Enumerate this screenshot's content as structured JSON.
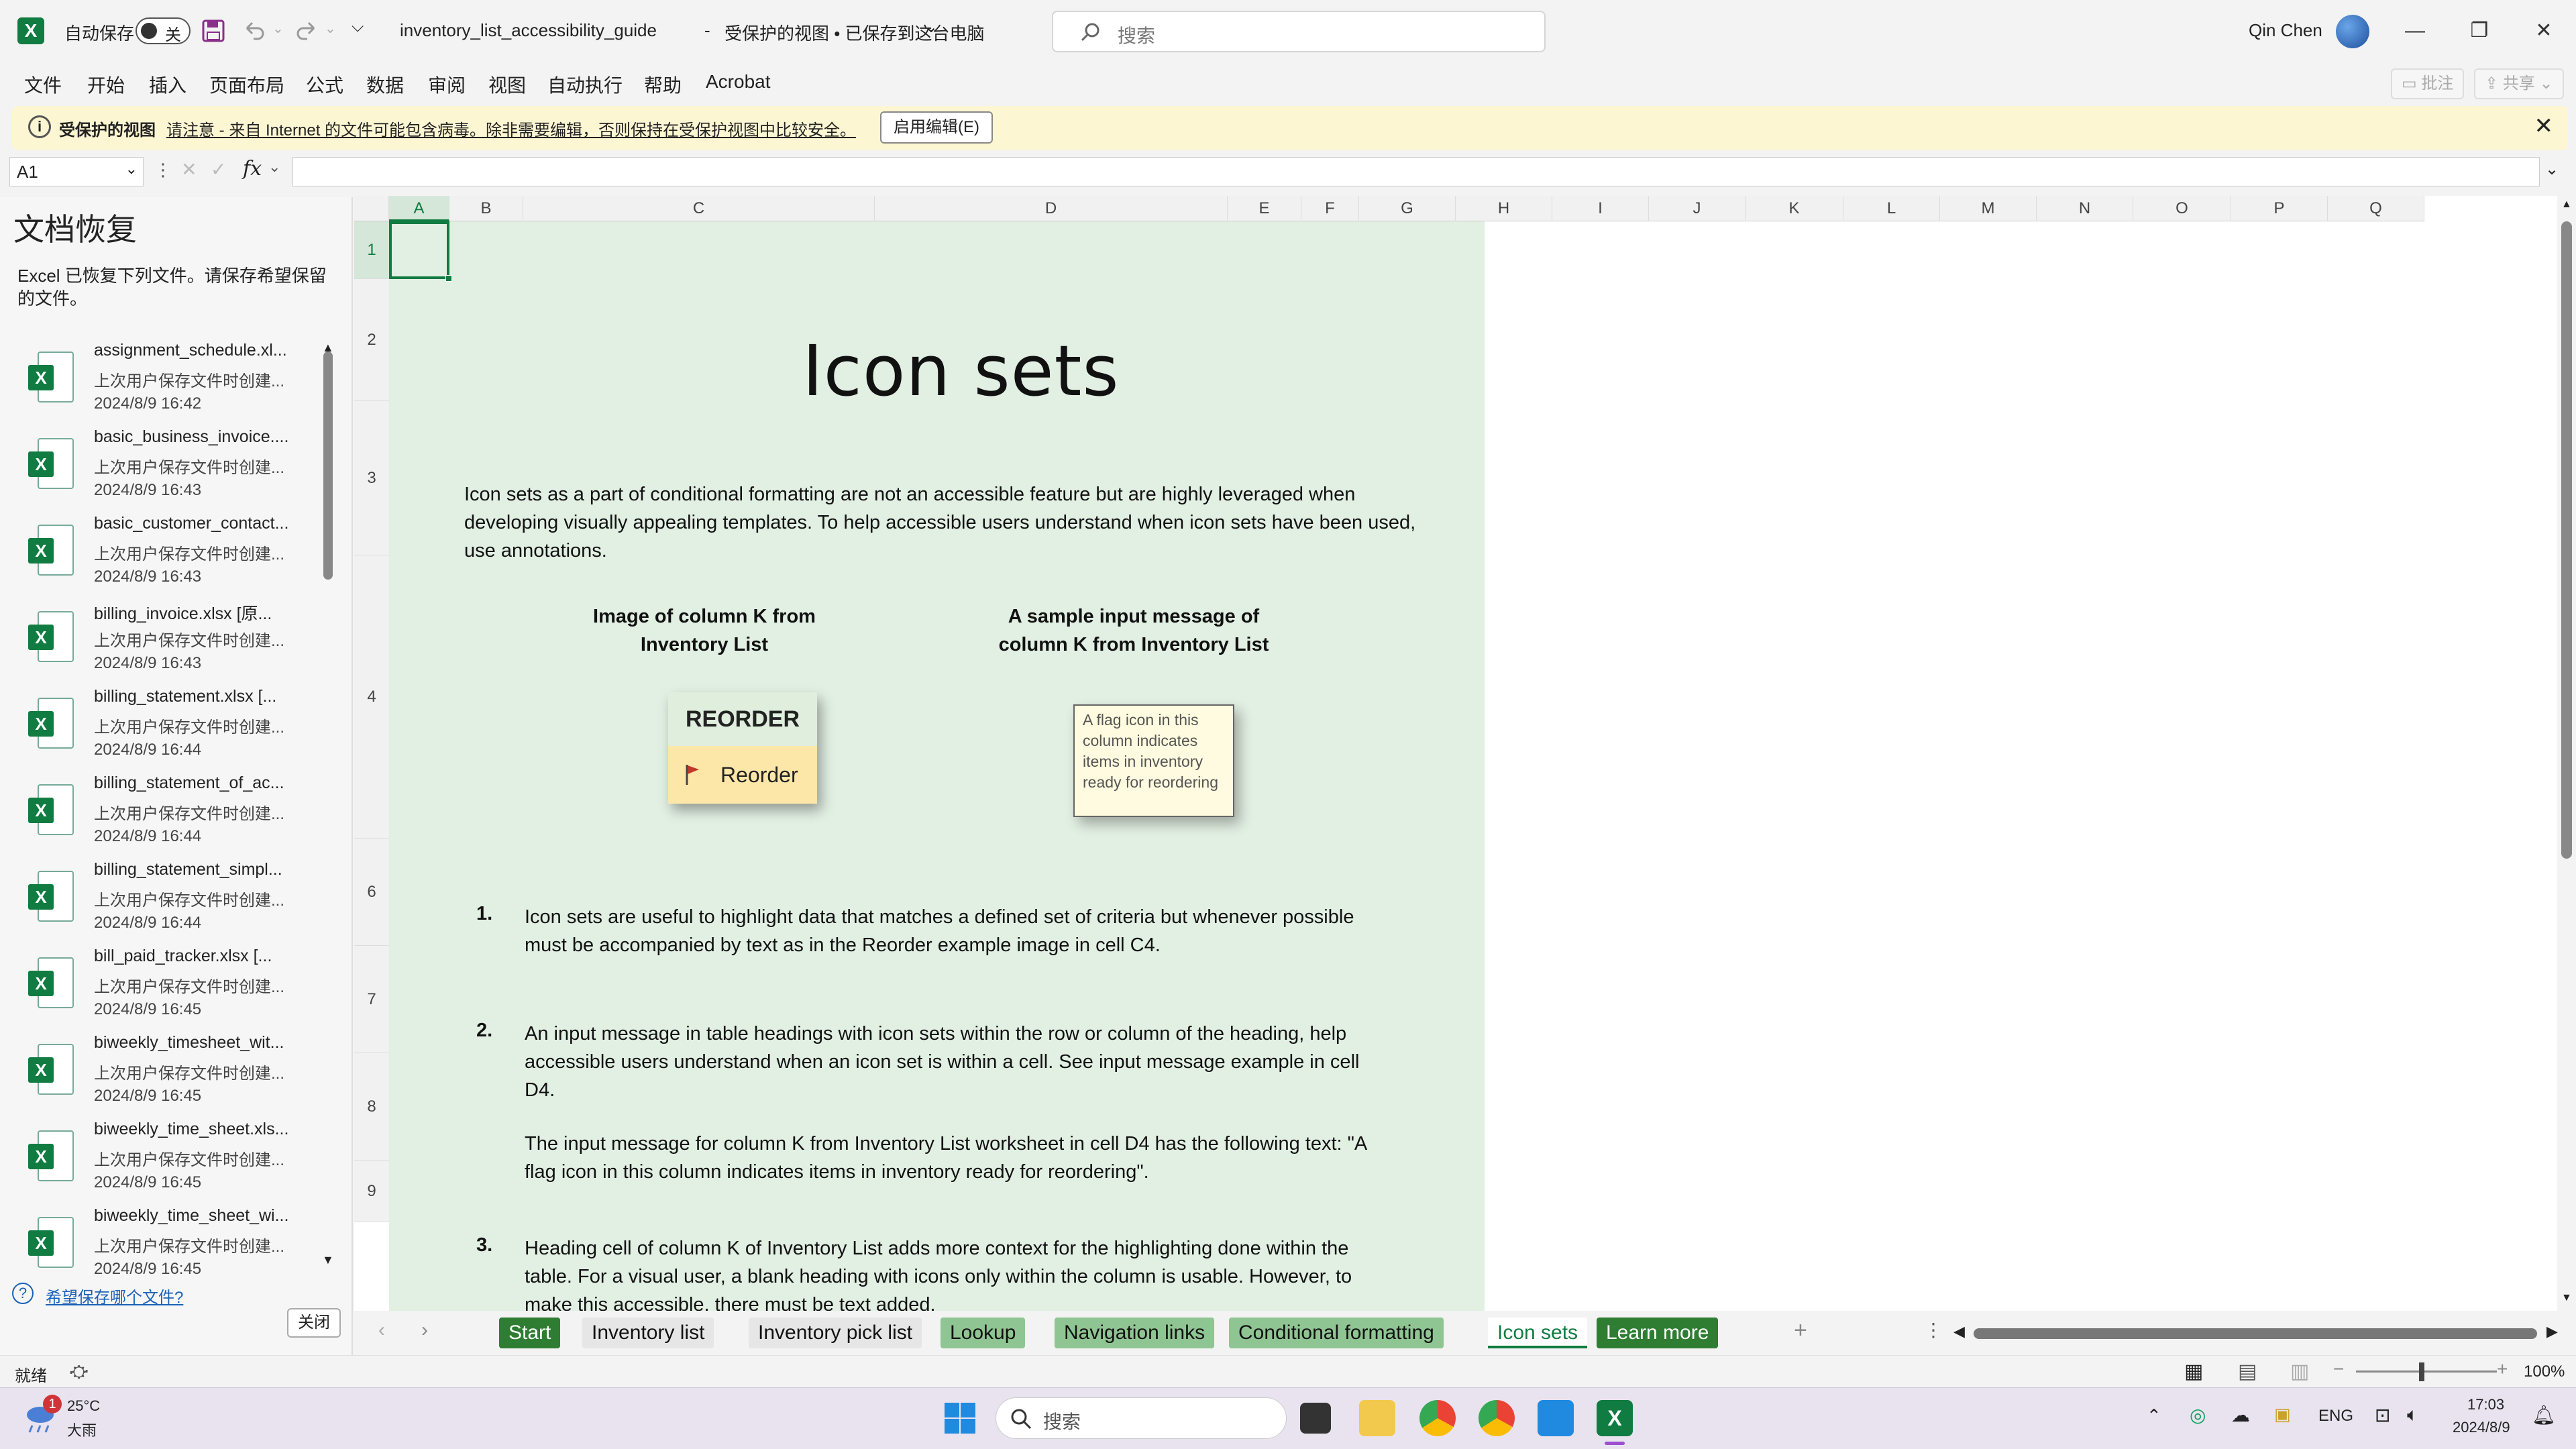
{
  "titlebar": {
    "autosave_label": "自动保存",
    "autosave_state": "关",
    "filename": "inventory_list_accessibility_guide",
    "separator": "-",
    "status": "受保护的视图 • 已保存到这台电脑",
    "search_placeholder": "搜索",
    "user_name": "Qin Chen"
  },
  "menu": {
    "items": [
      "文件",
      "开始",
      "插入",
      "页面布局",
      "公式",
      "数据",
      "审阅",
      "视图",
      "自动执行",
      "帮助",
      "Acrobat"
    ],
    "comments": "批注",
    "share": "共享"
  },
  "protected_bar": {
    "title": "受保护的视图",
    "message": "请注意 - 来自 Internet 的文件可能包含病毒。除非需要编辑，否则保持在受保护视图中比较安全。",
    "enable_button": "启用编辑(E)"
  },
  "formula_bar": {
    "name_box": "A1",
    "fx": "fx",
    "value": ""
  },
  "recovery": {
    "title": "文档恢复",
    "description": "Excel 已恢复下列文件。请保存希望保留的文件。",
    "files": [
      {
        "name": "assignment_schedule.xl...",
        "line": "上次用户保存文件时创建...",
        "date": "2024/8/9 16:42"
      },
      {
        "name": "basic_business_invoice....",
        "line": "上次用户保存文件时创建...",
        "date": "2024/8/9 16:43"
      },
      {
        "name": "basic_customer_contact...",
        "line": "上次用户保存文件时创建...",
        "date": "2024/8/9 16:43"
      },
      {
        "name": "billing_invoice.xlsx  [原...",
        "line": "上次用户保存文件时创建...",
        "date": "2024/8/9 16:43"
      },
      {
        "name": "billing_statement.xlsx  [...",
        "line": "上次用户保存文件时创建...",
        "date": "2024/8/9 16:44"
      },
      {
        "name": "billing_statement_of_ac...",
        "line": "上次用户保存文件时创建...",
        "date": "2024/8/9 16:44"
      },
      {
        "name": "billing_statement_simpl...",
        "line": "上次用户保存文件时创建...",
        "date": "2024/8/9 16:44"
      },
      {
        "name": "bill_paid_tracker.xlsx  [...",
        "line": "上次用户保存文件时创建...",
        "date": "2024/8/9 16:45"
      },
      {
        "name": "biweekly_timesheet_wit...",
        "line": "上次用户保存文件时创建...",
        "date": "2024/8/9 16:45"
      },
      {
        "name": "biweekly_time_sheet.xls...",
        "line": "上次用户保存文件时创建...",
        "date": "2024/8/9 16:45"
      },
      {
        "name": "biweekly_time_sheet_wi...",
        "line": "上次用户保存文件时创建...",
        "date": "2024/8/9 16:45"
      }
    ],
    "question": "希望保存哪个文件?",
    "close": "关闭"
  },
  "grid": {
    "columns": [
      "A",
      "B",
      "C",
      "D",
      "E",
      "F",
      "G",
      "H",
      "I",
      "J",
      "K",
      "L",
      "M",
      "N",
      "O",
      "P",
      "Q"
    ],
    "rows": [
      "1",
      "2",
      "3",
      "4",
      "6",
      "7",
      "8",
      "9"
    ]
  },
  "sheet": {
    "title": "Icon sets",
    "intro": "Icon sets as a part of conditional formatting are not an accessible feature but are highly leveraged when developing visually appealing templates. To help accessible users understand when icon sets have been used, use annotations.",
    "caption_left": "Image of column K from Inventory List",
    "caption_right": "A sample input message of column K from Inventory List",
    "reorder_header": "REORDER",
    "reorder_value": "Reorder",
    "tooltip": "A flag icon in this column indicates items in inventory ready for reordering",
    "items": [
      {
        "num": "1.",
        "text": "Icon sets are useful to highlight data that matches a defined set of criteria but whenever possible must be accompanied by text as in the Reorder example image in cell C4."
      },
      {
        "num": "2.",
        "text": "An input message in table headings with icon sets within the row or column of the heading, help accessible users understand when an icon set is within a cell. See input message example in cell D4."
      },
      {
        "num": "",
        "text": "The input message for column K from Inventory List worksheet in cell D4 has the following text: \"A flag icon in this column indicates items in inventory ready for reordering\"."
      },
      {
        "num": "3.",
        "text": "Heading cell of column K of Inventory List adds more context for the highlighting done within the table. For a visual user, a blank heading with icons only within the column is usable. However, to make this accessible, there must be text added."
      }
    ]
  },
  "tabs": [
    {
      "label": "Start",
      "style": "dark"
    },
    {
      "label": "Inventory list",
      "style": "light"
    },
    {
      "label": "Inventory pick list",
      "style": "light"
    },
    {
      "label": "Lookup",
      "style": "green"
    },
    {
      "label": "Navigation links",
      "style": "green"
    },
    {
      "label": "Conditional formatting",
      "style": "green"
    },
    {
      "label": "Icon sets",
      "style": "active"
    },
    {
      "label": "Learn more",
      "style": "dark"
    }
  ],
  "statusbar": {
    "ready": "就绪",
    "zoom": "100%"
  },
  "taskbar": {
    "weather_temp": "25°C",
    "weather_desc": "大雨",
    "weather_badge": "1",
    "search_placeholder": "搜索",
    "lang": "ENG",
    "time": "17:03",
    "date": "2024/8/9"
  },
  "colors": {
    "excel_green": "#107c41",
    "sheet_bg": "#e2efe3",
    "tab_green": "#8fc592",
    "tab_dark": "#2e7d32",
    "warning_bar": "#fdf6d3"
  }
}
